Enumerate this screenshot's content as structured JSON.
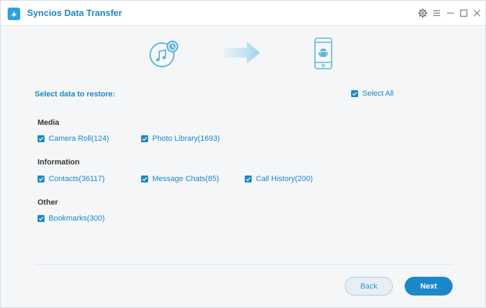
{
  "app": {
    "title": "Syncios Data Transfer",
    "accent_color": "#1a88c9"
  },
  "titlebar": {
    "icons": [
      "settings-icon",
      "menu-icon",
      "minimize-icon",
      "maximize-icon",
      "close-icon"
    ]
  },
  "transfer": {
    "source_icon": "music-backup-icon",
    "arrow_icon": "arrow-right-icon",
    "target_icon": "android-phone-icon"
  },
  "restore": {
    "heading": "Select data to restore:",
    "select_all_label": "Select All",
    "categories": [
      {
        "name": "Media",
        "items": [
          "Camera Roll(124)",
          "Photo Library(1693)"
        ]
      },
      {
        "name": "Information",
        "items": [
          "Contacts(36117)",
          "Message Chats(85)",
          "Call History(200)"
        ]
      },
      {
        "name": "Other",
        "items": [
          "Bookmarks(300)"
        ]
      }
    ]
  },
  "footer": {
    "back_label": "Back",
    "next_label": "Next"
  }
}
